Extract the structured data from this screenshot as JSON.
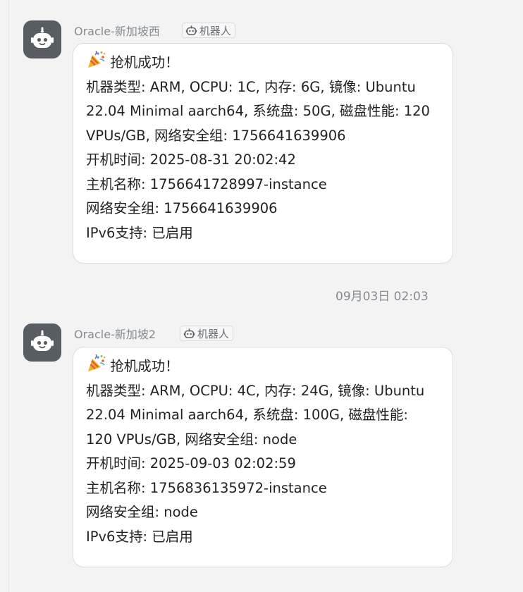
{
  "messages": [
    {
      "sender": "Oracle-新加坡西",
      "badge": "机器人",
      "lines": [
        "抢机成功！",
        "机器类型: ARM, OCPU: 1C, 内存: 6G, 镜像: Ubuntu",
        "22.04 Minimal aarch64, 系统盘: 50G, 磁盘性能: 120",
        "VPUs/GB, 网络安全组: 1756641639906",
        "开机时间: 2025-08-31 20:02:42",
        "主机名称: 1756641728997-instance",
        "网络安全组: 1756641639906",
        "IPv6支持: 已启用"
      ]
    },
    {
      "sender": "Oracle-新加坡2",
      "badge": "机器人",
      "lines": [
        "抢机成功！",
        "机器类型: ARM, OCPU: 4C, 内存: 24G, 镜像: Ubuntu",
        "22.04 Minimal aarch64, 系统盘: 100G, 磁盘性能:",
        "120 VPUs/GB, 网络安全组: node",
        "开机时间: 2025-09-03 02:02:59",
        "主机名称: 1756836135972-instance",
        "网络安全组: node",
        "IPv6支持: 已启用"
      ]
    }
  ],
  "timestamp": "09月03日 02:03",
  "icons": {
    "avatar": "robot-icon",
    "badge": "robot-icon",
    "celebration": "party-popper-icon"
  },
  "colors": {
    "background": "#f3f3f3",
    "avatar": "#585d63",
    "bubble": "#ffffff",
    "muted_text": "#858b92"
  }
}
